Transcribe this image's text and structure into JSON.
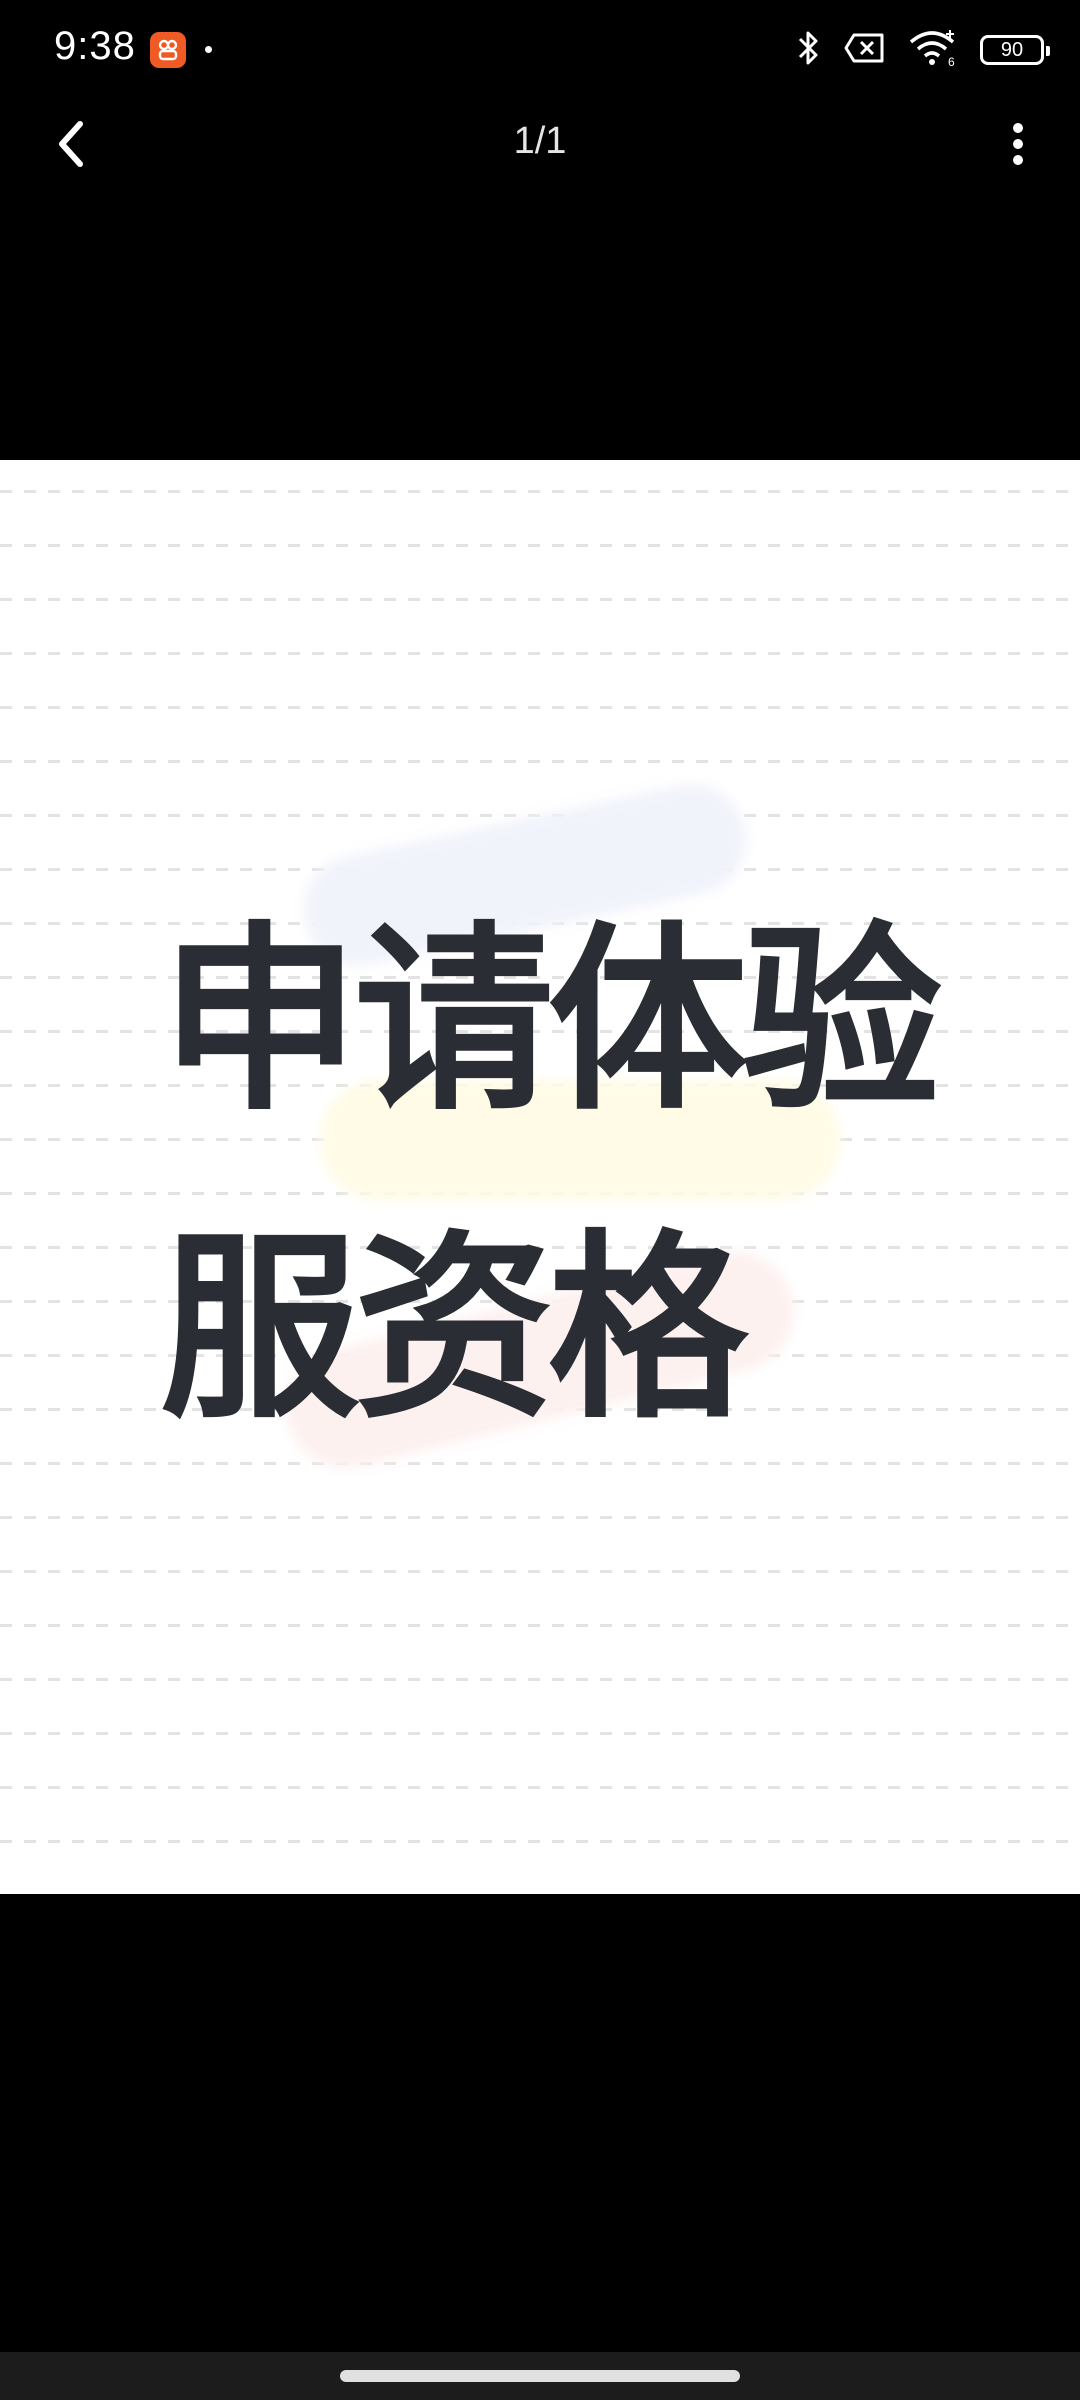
{
  "status_bar": {
    "time": "9:38",
    "battery_level": "90",
    "icons": [
      "app-badge-icon",
      "bluetooth-icon",
      "sim-x-icon",
      "wifi-6-icon",
      "battery-icon"
    ]
  },
  "top_nav": {
    "page_counter": "1/1",
    "back_icon": "chevron-left-icon",
    "more_icon": "more-vertical-icon"
  },
  "image": {
    "line1": "申请体验",
    "line2": "服资格",
    "text_color": "#2a2d33",
    "background": "#ffffff"
  },
  "colors": {
    "app_bg": "#000000",
    "badge": "#f05a24"
  }
}
